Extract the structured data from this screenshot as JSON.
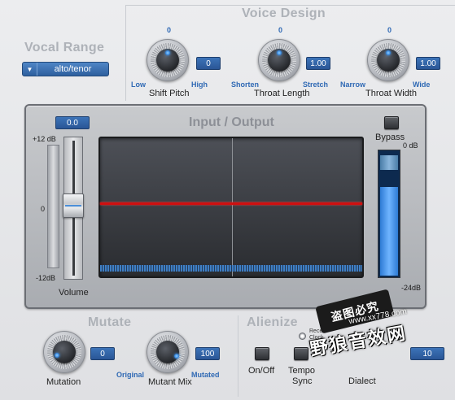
{
  "sections": {
    "voice_design": "Voice Design",
    "vocal_range": "Vocal Range",
    "mutate": "Mutate",
    "alienize": "Alienize"
  },
  "vocal_range": {
    "selected": "alto/tenor"
  },
  "knobs": {
    "shift_pitch": {
      "label": "Shift Pitch",
      "zero": "0",
      "value": "0",
      "low": "Low",
      "high": "High"
    },
    "throat_length": {
      "label": "Throat Length",
      "zero": "0",
      "value": "1.00",
      "low": "Shorten",
      "high": "Stretch"
    },
    "throat_width": {
      "label": "Throat Width",
      "zero": "0",
      "value": "1.00",
      "low": "Narrow",
      "high": "Wide"
    },
    "mutation": {
      "label": "Mutation",
      "value": "0"
    },
    "mutant_mix": {
      "label": "Mutant Mix",
      "value": "100",
      "low": "Original",
      "high": "Mutated"
    }
  },
  "io": {
    "title": "Input / Output",
    "volume_value": "0.0",
    "volume_label": "Volume",
    "scale_top": "+12 dB",
    "scale_mid": "0",
    "scale_bottom": "-12dB",
    "bypass_label": "Bypass",
    "meter_top": "0 dB",
    "meter_bottom": "-24dB",
    "meter_level": 0.85
  },
  "alienize": {
    "onoff_label": "On/Off",
    "tempo_sync_line1": "Tempo",
    "tempo_sync_line2": "Sync",
    "radio_label_1": "Recei",
    "radio_label_2": "Clock",
    "dialect_label": "Dialect",
    "dialect_value": "10"
  },
  "watermark": {
    "badge": "盗图必究",
    "text": "野狼音效网",
    "url": "www.xx778.com"
  }
}
